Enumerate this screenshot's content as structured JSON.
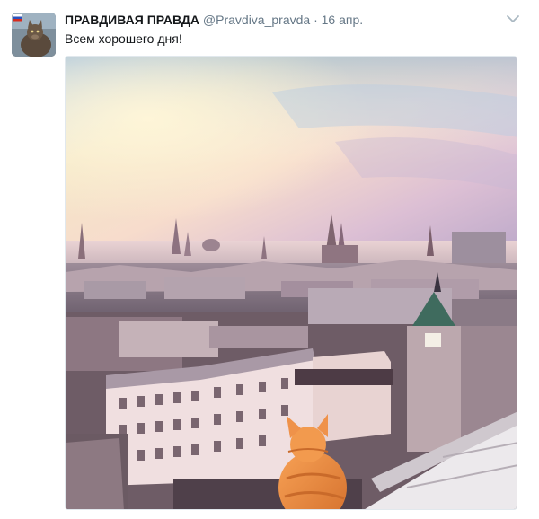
{
  "tweet": {
    "display_name": "ПРАВДИВАЯ ПРАВДА",
    "screen_name": "@Pravdiva_pravda",
    "separator": "·",
    "timestamp": "16 апр.",
    "text": "Всем хорошего дня!",
    "avatar_icon": "cat-avatar-icon",
    "menu_icon": "chevron-down-icon"
  },
  "media": {
    "kind": "photo",
    "subject": "sunrise-over-moscow-rooftops-with-ginger-cat"
  },
  "colors": {
    "text_primary": "#14171a",
    "text_secondary": "#657786",
    "border": "#e1e8ed"
  }
}
